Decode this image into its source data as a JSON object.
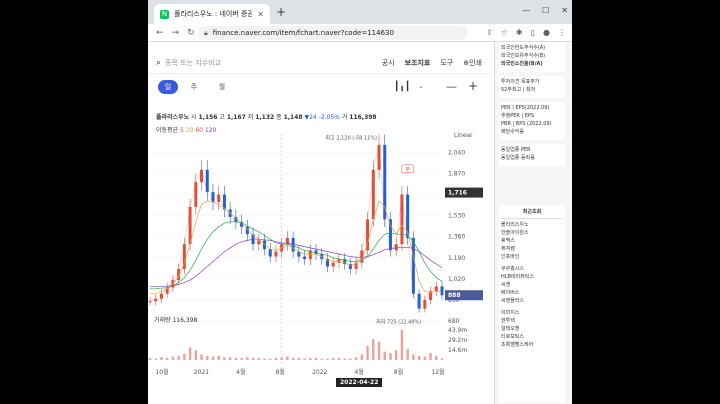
{
  "browser": {
    "tab_title": "폴라리스우노 : 네이버 증권",
    "url": "finance.naver.com/item/fchart.naver?code=114630"
  },
  "search": {
    "placeholder": "종목 또는 지수비교"
  },
  "menu": {
    "items": [
      "공시",
      "보조지표",
      "도구",
      "⊕인쇄"
    ]
  },
  "periods": [
    "일",
    "주",
    "월"
  ],
  "stock": {
    "name": "폴라리스우노",
    "open_label": "시",
    "open": "1,156",
    "high_label": "고",
    "high": "1,167",
    "low_label": "저",
    "low": "1,132",
    "close_label": "종",
    "close": "1,148",
    "change": "▼24",
    "change_pct": "-2.05%",
    "volume_label": "거",
    "volume": "116,398"
  },
  "moving_average": {
    "label": "이동평균",
    "periods": [
      "5",
      "20",
      "60",
      "120"
    ]
  },
  "scale_label": "Linear",
  "annotations": {
    "max": "최고 2,120 (-58.11%)",
    "min": "최저 725 (22.48%)",
    "event_badge": "무",
    "current_price": "1,716",
    "last_price": "888",
    "crosshair_date": "2022-04-22"
  },
  "volume_panel": {
    "label": "거래량",
    "value": "116,398",
    "ticks": [
      "43.9m",
      "29.2m",
      "14.6m"
    ]
  },
  "chart_data": {
    "type": "line",
    "title": "",
    "y_ticks": [
      2040,
      1870,
      1700,
      1530,
      1360,
      1190,
      1020,
      850,
      680
    ],
    "x_ticks": [
      "10월",
      "2021",
      "4월",
      "8월",
      "2022",
      "4월",
      "8월",
      "12월"
    ],
    "ylim": [
      640,
      2140
    ],
    "series": [
      {
        "values": [
          840,
          860,
          900,
          950,
          1010,
          1100,
          1300,
          1600,
          1800,
          1900,
          1720,
          1640,
          1700,
          1580,
          1520,
          1480,
          1440,
          1380,
          1300,
          1330,
          1260,
          1200,
          1240,
          1300,
          1350,
          1240,
          1200,
          1180,
          1250,
          1220,
          1180,
          1120,
          1150,
          1180,
          1140,
          1100,
          1150,
          1250,
          1500,
          1900,
          2100,
          1500,
          1250,
          1300,
          1700,
          1350,
          900,
          780,
          850,
          920,
          960,
          888
        ]
      },
      {
        "values": [
          900,
          900,
          920,
          940,
          980,
          1040,
          1150,
          1300,
          1480,
          1620,
          1650,
          1640,
          1620,
          1590,
          1550,
          1510,
          1470,
          1420,
          1370,
          1340,
          1300,
          1260,
          1250,
          1270,
          1290,
          1270,
          1240,
          1220,
          1220,
          1220,
          1200,
          1170,
          1160,
          1160,
          1150,
          1130,
          1140,
          1180,
          1300,
          1500,
          1650,
          1600,
          1450,
          1380,
          1450,
          1400,
          1200,
          1000,
          920,
          910,
          920,
          910
        ]
      },
      {
        "values": [
          940,
          940,
          945,
          950,
          960,
          990,
          1030,
          1090,
          1170,
          1260,
          1340,
          1400,
          1440,
          1470,
          1480,
          1480,
          1470,
          1450,
          1420,
          1400,
          1370,
          1340,
          1310,
          1300,
          1300,
          1290,
          1270,
          1250,
          1240,
          1230,
          1220,
          1210,
          1190,
          1180,
          1170,
          1160,
          1160,
          1170,
          1200,
          1260,
          1330,
          1380,
          1390,
          1380,
          1380,
          1370,
          1320,
          1240,
          1150,
          1080,
          1030,
          1000
        ]
      },
      {
        "values": [
          960,
          960,
          960,
          962,
          965,
          975,
          990,
          1010,
          1040,
          1080,
          1120,
          1160,
          1200,
          1240,
          1270,
          1300,
          1320,
          1330,
          1340,
          1340,
          1335,
          1330,
          1320,
          1310,
          1305,
          1300,
          1290,
          1280,
          1270,
          1260,
          1250,
          1240,
          1230,
          1220,
          1210,
          1200,
          1195,
          1195,
          1200,
          1215,
          1235,
          1255,
          1265,
          1270,
          1275,
          1275,
          1265,
          1240,
          1205,
          1170,
          1140,
          1110
        ]
      }
    ],
    "volume": [
      3,
      2,
      4,
      3,
      5,
      6,
      9,
      18,
      14,
      8,
      6,
      5,
      6,
      4,
      4,
      3,
      3,
      4,
      3,
      3,
      2,
      2,
      3,
      4,
      5,
      3,
      3,
      2,
      3,
      3,
      2,
      2,
      3,
      3,
      2,
      2,
      4,
      8,
      20,
      30,
      26,
      12,
      10,
      14,
      43,
      16,
      8,
      6,
      5,
      10,
      6,
      2
    ],
    "series_colors": [
      "#e04f3c",
      "#e8a33d",
      "#2fa84f",
      "#8a3fcf"
    ],
    "volume_color": "#f0a09a",
    "grid": true
  },
  "sidebar": {
    "investor_rows": [
      "외국인한도주식수(A)",
      "외국인보유주식수(B)",
      "외국인소진율(B/A)"
    ],
    "opinion_rows": [
      "투자의견  목표주가",
      "52주최고 | 최저"
    ],
    "per_rows": [
      "PER | EPS(2022.09)",
      "추정PER | EPS",
      "PBR | BPS (2022.09)",
      "배당수익률"
    ],
    "industry_rows": [
      "동일업종 PER",
      "동일업종 등락률"
    ],
    "recent_title": "최근조회",
    "recent_items": [
      "폴라리스우노",
      "한솔아이원스",
      "휴맥스",
      "퓨쳐켐",
      "인포바인",
      "쿠쿠홈시스",
      "HLB테라퓨틱스",
      "씨젠",
      "베이버스",
      "씨엔플러스",
      "이미지스",
      "엔투텍",
      "알테오젠",
      "티로보틱스",
      "초록뱀헬스케어"
    ]
  },
  "colors": {
    "accent": "#3a5bd9",
    "up": "#e04f3c",
    "down": "#1e63d6",
    "price_tag": "#4a5a9a"
  }
}
